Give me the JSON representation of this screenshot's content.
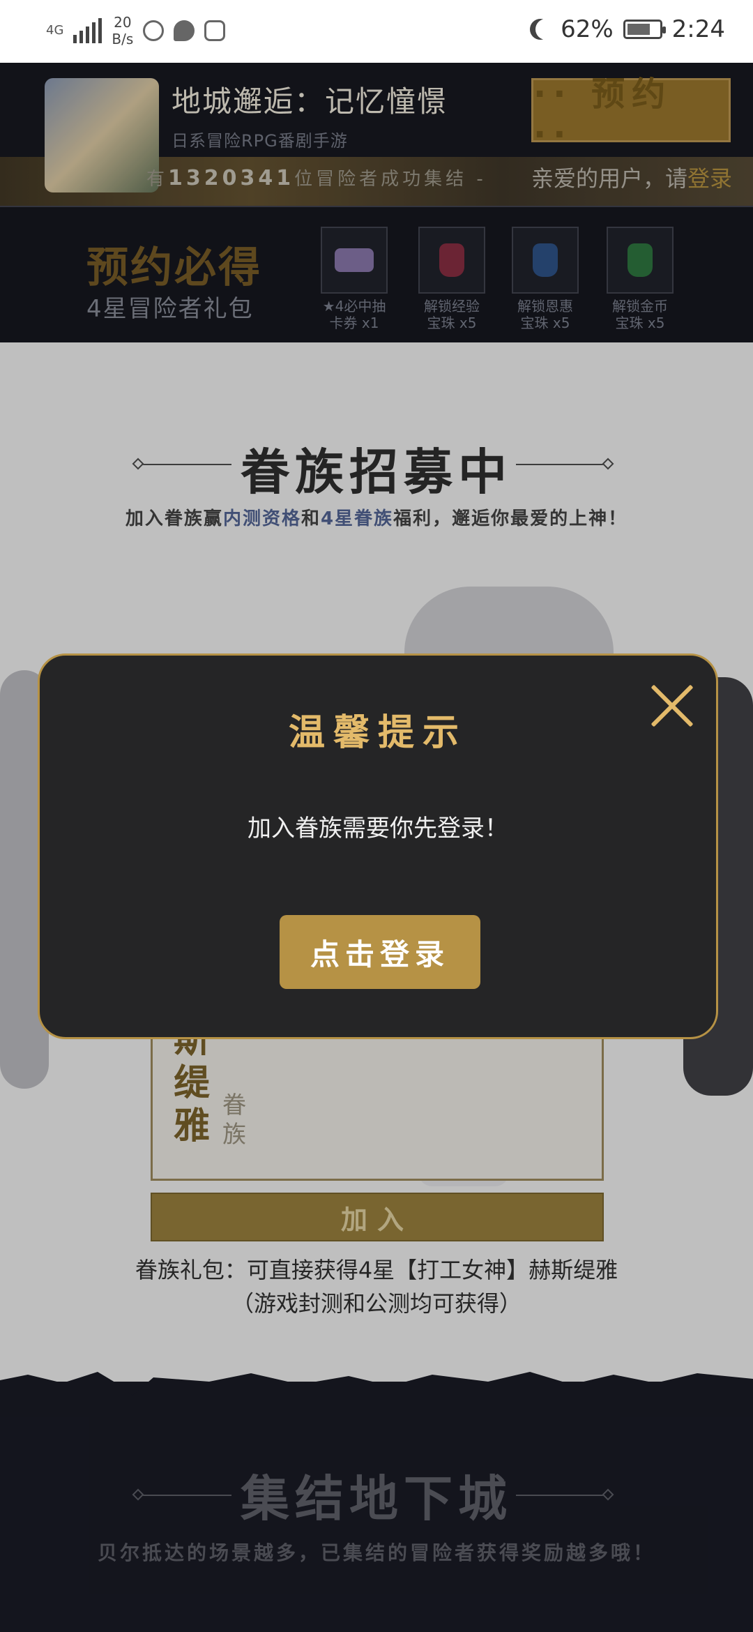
{
  "status_bar": {
    "network": "4G",
    "speed_value": "20",
    "speed_unit": "B/s",
    "battery": "62%",
    "time": "2:24"
  },
  "header": {
    "game_title": "地城邂逅：记忆憧憬",
    "game_subtitle": "日系冒险RPG番剧手游",
    "reserve_label": "·· 预约 ··",
    "counter_prefix": "有",
    "counter_value": "1320341",
    "counter_suffix": "位冒险者成功集结 -",
    "greeting": "亲爱的用户，请",
    "login_link": "登录"
  },
  "gift": {
    "title": "预约必得",
    "subtitle": "4星冒险者礼包",
    "items": [
      {
        "line1": "★4必中抽",
        "line2": "卡券 x1",
        "color": "#7b6c9a"
      },
      {
        "line1": "解锁经验",
        "line2": "宝珠 x5",
        "color": "#7a2a3c"
      },
      {
        "line1": "解锁恩惠",
        "line2": "宝珠 x5",
        "color": "#2a4a7a"
      },
      {
        "line1": "解锁金币",
        "line2": "宝珠 x5",
        "color": "#2a6a3a"
      }
    ]
  },
  "familia": {
    "title": "眷族招募中",
    "desc_1": "加入眷族赢",
    "desc_highlight_1": "内测资格",
    "desc_2": "和",
    "desc_highlight_2": "4星眷族",
    "desc_3": "福利，邂逅你最爱的上神！",
    "card_name": "斯缇雅",
    "card_small": "眷族",
    "join_label": "加入",
    "pack_line1": "眷族礼包：可直接获得4星【打工女神】赫斯缇雅",
    "pack_line2": "（游戏封测和公测均可获得）"
  },
  "dungeon": {
    "title": "集结地下城",
    "desc": "贝尔抵达的场景越多，已集结的冒险者获得奖励越多哦！"
  },
  "modal": {
    "title": "温馨提示",
    "message": "加入眷族需要你先登录！",
    "login_button": "点击登录"
  },
  "colors": {
    "accent_gold": "#b69245",
    "modal_bg": "#252526",
    "highlight_blue": "#4a5b86"
  }
}
